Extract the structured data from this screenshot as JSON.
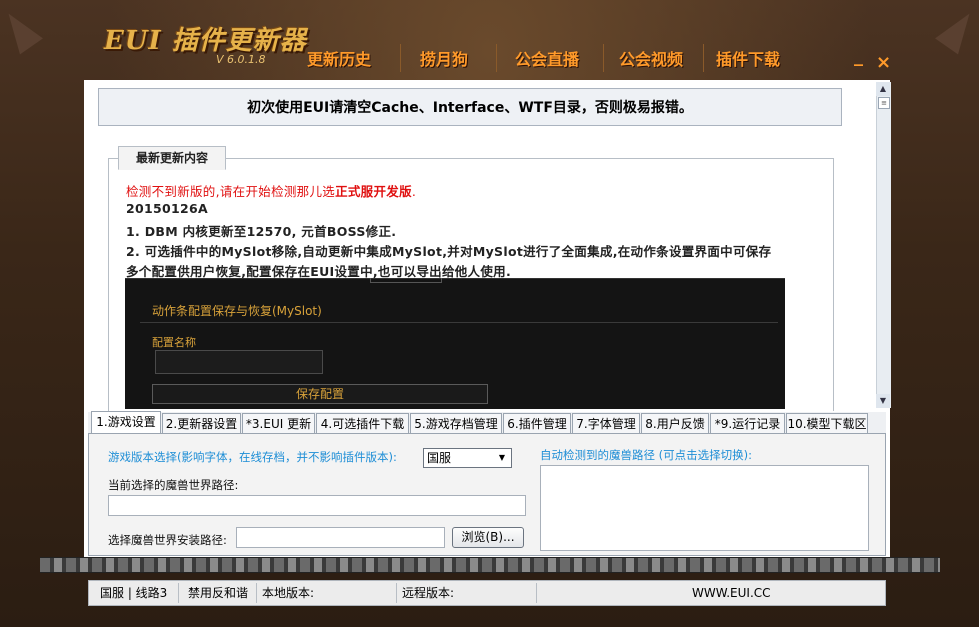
{
  "window": {
    "title": "EUI 插件更新器",
    "version": "V 6.0.1.8",
    "minimize": "_",
    "close": "×"
  },
  "topnav": [
    "更新历史",
    "捞月狗",
    "公会直播",
    "公会视频",
    "插件下载"
  ],
  "notice": "初次使用EUI请清空Cache、Interface、WTF目录，否则极易报错。",
  "update_group": {
    "title": "最新更新内容",
    "warn_prefix": "检测不到新版的,请在开始检测那儿选",
    "warn_bold": "正式服开发版",
    "warn_suffix": ".",
    "version_line": "20150126A",
    "item1": "1. DBM 内核更新至12570, 元首BOSS修正.",
    "item2a": "2. 可选插件中的MySlot移除,自动更新中集成MySlot,并对MySlot进行了全面集成,在动作条设置界面中可保存",
    "item2b": "多个配置供用户恢复,配置保存在EUI设置中,也可以导出给他人使用."
  },
  "screenshot": {
    "title": "动作条配置保存与恢复(MySlot)",
    "name_label": "配置名称",
    "save_button": "保存配置"
  },
  "tabs": [
    "1.游戏设置",
    "2.更新器设置",
    "*3.EUI 更新",
    "4.可选插件下载",
    "5.游戏存档管理",
    "6.插件管理",
    "7.字体管理",
    "8.用户反馈",
    "*9.运行记录",
    "10.模型下载区"
  ],
  "active_tab": "1.游戏设置",
  "game_settings": {
    "version_label": "游戏版本选择(影响字体，在线存档，并不影响插件版本):",
    "version_value": "国服",
    "current_path_label": "当前选择的魔兽世界路径:",
    "current_path_value": "",
    "install_path_label": "选择魔兽世界安装路径:",
    "install_path_value": "",
    "browse_button": "浏览(B)...",
    "auto_detect_label": "自动检测到的魔兽路径 (可点击选择切换):"
  },
  "statusbar": {
    "server": "国服 | 线路3",
    "harmony": "禁用反和谐",
    "local_version": "本地版本:",
    "remote_version": "远程版本:",
    "website": "WWW.EUI.CC"
  },
  "colors": {
    "nav_orange": "#ff9a2a",
    "logo_gold": "#e6b24a",
    "warn_red": "#e01010",
    "label_blue": "#1e8ed6"
  }
}
